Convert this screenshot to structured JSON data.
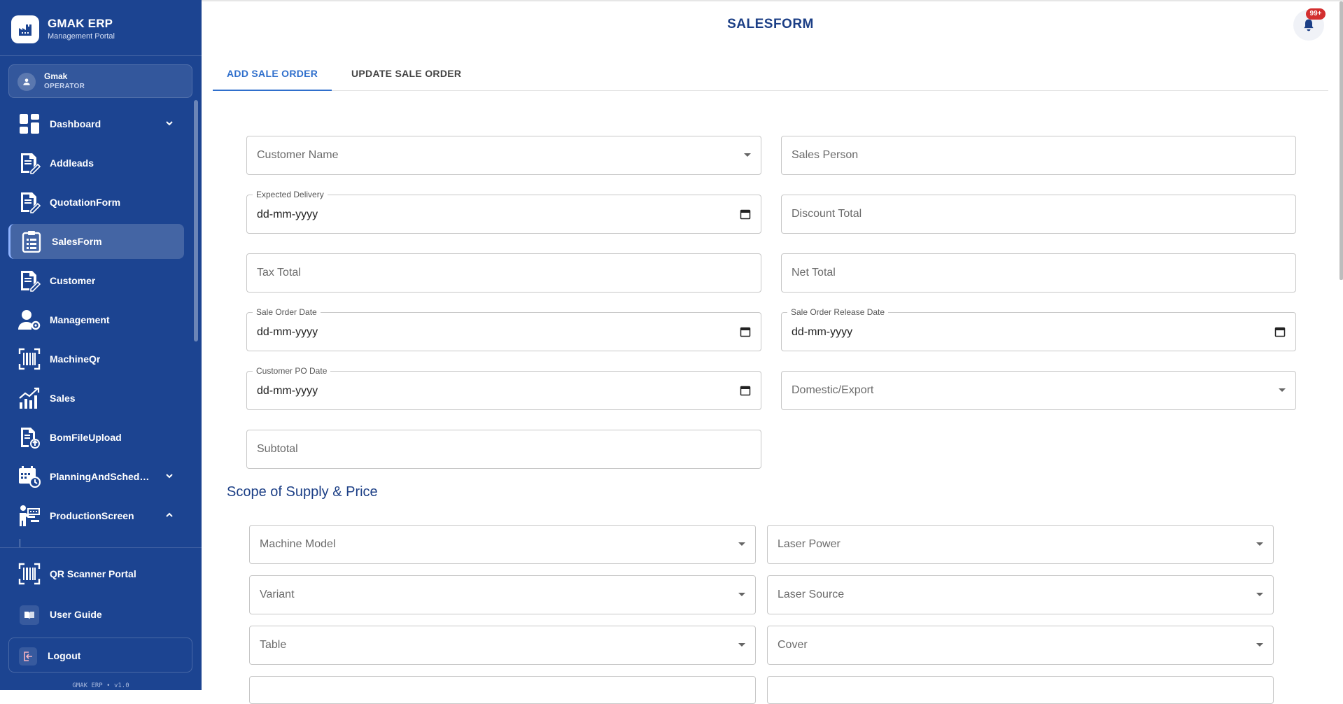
{
  "brand": {
    "title": "GMAK ERP",
    "subtitle": "Management Portal"
  },
  "user": {
    "name": "Gmak",
    "role": "OPERATOR"
  },
  "nav": {
    "items": [
      {
        "label": "Dashboard",
        "icon": "dashboard-icon",
        "expandable": true
      },
      {
        "label": "Addleads",
        "icon": "edit-document-icon"
      },
      {
        "label": "QuotationForm",
        "icon": "edit-document-icon"
      },
      {
        "label": "SalesForm",
        "icon": "clipboard-list-icon",
        "active": true
      },
      {
        "label": "Customer",
        "icon": "edit-document-icon"
      },
      {
        "label": "Management",
        "icon": "user-gear-icon"
      },
      {
        "label": "MachineQr",
        "icon": "qr-scan-icon"
      },
      {
        "label": "Sales",
        "icon": "chart-growth-icon"
      },
      {
        "label": "BomFileUpload",
        "icon": "file-upload-icon"
      },
      {
        "label": "PlanningAndSchedul…",
        "icon": "calendar-clock-icon",
        "expandable": true
      },
      {
        "label": "ProductionScreen",
        "icon": "worker-screen-icon",
        "expandable": true,
        "expanded": true
      }
    ]
  },
  "bottom": {
    "qr_label": "QR Scanner Portal",
    "guide_label": "User Guide",
    "logout_label": "Logout",
    "version": "GMAK ERP • v1.0"
  },
  "header": {
    "title": "SALESFORM",
    "notification_count": "99+"
  },
  "tabs": [
    {
      "label": "ADD SALE ORDER",
      "active": true
    },
    {
      "label": "UPDATE SALE ORDER"
    }
  ],
  "form": {
    "customer_name": "Customer Name",
    "sales_person": "Sales Person",
    "expected_delivery_label": "Expected Delivery",
    "expected_delivery_value": "dd-mm-yyyy",
    "discount_total": "Discount Total",
    "tax_total": "Tax Total",
    "net_total": "Net Total",
    "sale_order_date_label": "Sale Order Date",
    "sale_order_date_value": "dd-mm-yyyy",
    "sale_order_release_label": "Sale Order Release Date",
    "sale_order_release_value": "dd-mm-yyyy",
    "customer_po_label": "Customer PO Date",
    "customer_po_value": "dd-mm-yyyy",
    "domestic_export": "Domestic/Export",
    "subtotal": "Subtotal"
  },
  "scope": {
    "title": "Scope of Supply & Price",
    "machine_model": "Machine Model",
    "laser_power": "Laser Power",
    "variant": "Variant",
    "laser_source": "Laser Source",
    "table": "Table",
    "cover": "Cover"
  },
  "colors": {
    "sidebar": "#1c4491",
    "accent": "#2f6fcc",
    "title": "#1c3f86",
    "badge": "#d32f2f"
  }
}
